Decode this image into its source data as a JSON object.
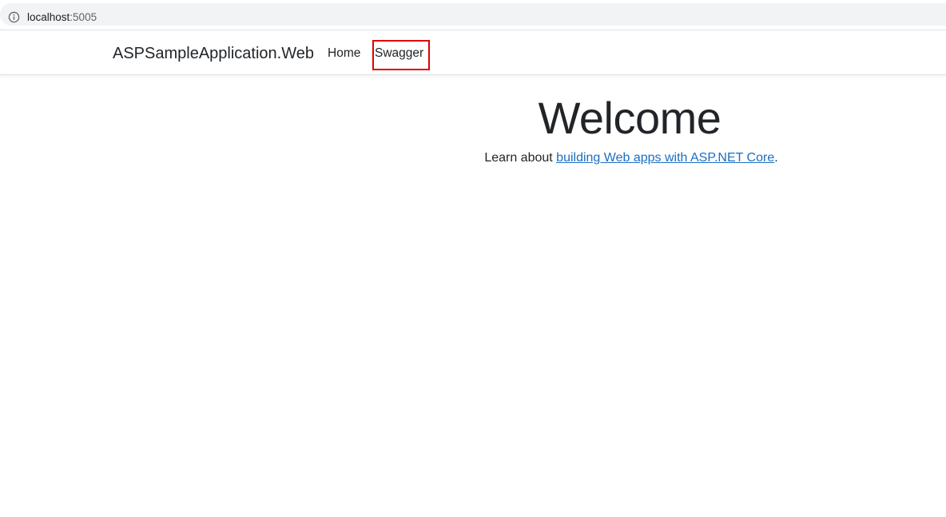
{
  "browser": {
    "url_host": "localhost",
    "url_port": ":5005",
    "info_icon": "info-icon"
  },
  "navbar": {
    "brand": "ASPSampleApplication.Web",
    "links": [
      {
        "label": "Home"
      },
      {
        "label": "Swagger"
      }
    ],
    "highlight_color": "#e00000"
  },
  "main": {
    "heading": "Welcome",
    "learn_prefix": "Learn about ",
    "learn_link": "building Web apps with ASP.NET Core",
    "learn_suffix": "."
  },
  "colors": {
    "link": "#1b6ec2",
    "text": "#212529"
  }
}
